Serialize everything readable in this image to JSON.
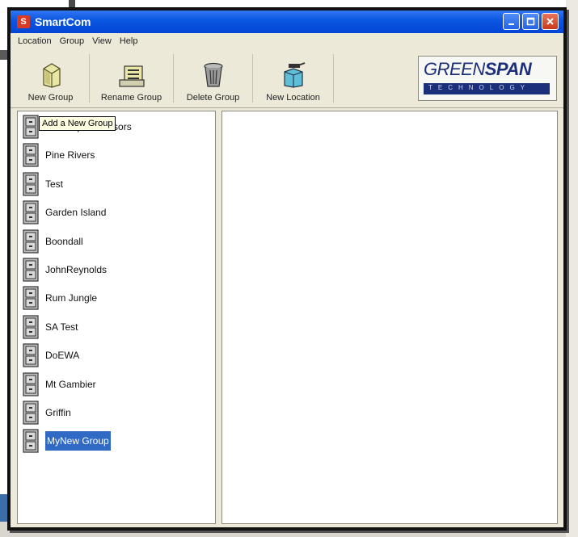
{
  "window": {
    "title": "SmartCom",
    "app_icon": "S"
  },
  "menu": [
    "Location",
    "Group",
    "View",
    "Help"
  ],
  "toolbar": {
    "buttons": [
      {
        "label": "New Group",
        "icon": "new-group-icon"
      },
      {
        "label": "Rename Group",
        "icon": "rename-group-icon"
      },
      {
        "label": "Delete Group",
        "icon": "trash-icon"
      },
      {
        "label": "New Location",
        "icon": "new-location-icon"
      }
    ]
  },
  "logo": {
    "word_light": "GREEN",
    "word_bold": "SPAN",
    "tagline": "TECHNOLOGY"
  },
  "tooltip": "Add a New Group",
  "groups": [
    {
      "label": "Greenspan Sensors",
      "selected": false
    },
    {
      "label": "Pine Rivers",
      "selected": false
    },
    {
      "label": "Test",
      "selected": false
    },
    {
      "label": "Garden Island",
      "selected": false
    },
    {
      "label": "Boondall",
      "selected": false
    },
    {
      "label": "JohnReynolds",
      "selected": false
    },
    {
      "label": "Rum Jungle",
      "selected": false
    },
    {
      "label": "SA Test",
      "selected": false
    },
    {
      "label": "DoEWA",
      "selected": false
    },
    {
      "label": "Mt Gambier",
      "selected": false
    },
    {
      "label": "Griffin",
      "selected": false
    },
    {
      "label": "MyNew Group",
      "selected": true
    }
  ],
  "colors": {
    "titlebar": "#0a55e0",
    "selection": "#316ac5",
    "logo_blue": "#1c2f7a"
  }
}
